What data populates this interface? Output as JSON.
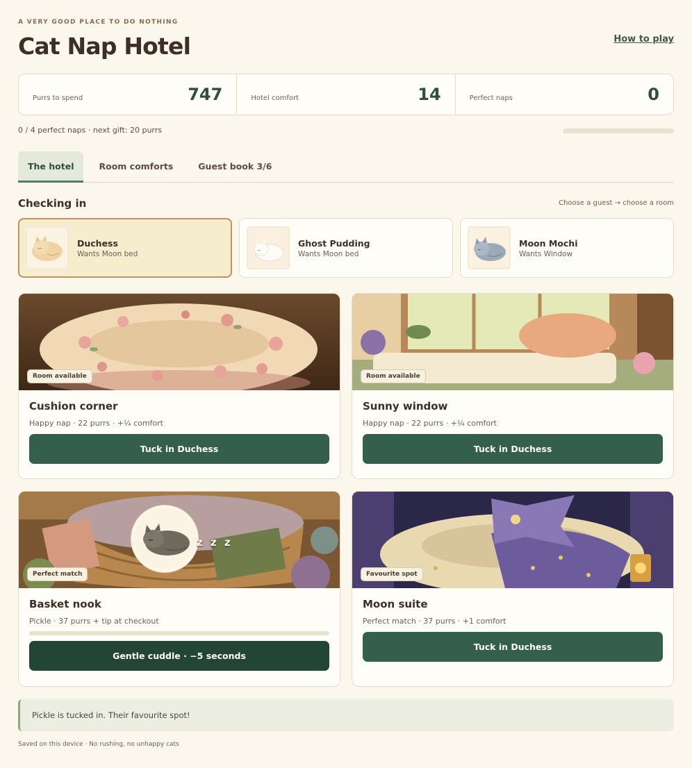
{
  "header": {
    "eyebrow": "A VERY GOOD PLACE TO DO NOTHING",
    "title": "Cat Nap Hotel",
    "how_to_play": "How to play"
  },
  "stats": [
    {
      "label": "Purrs to spend",
      "value": "747"
    },
    {
      "label": "Hotel comfort",
      "value": "14"
    },
    {
      "label": "Perfect naps",
      "value": "0"
    }
  ],
  "progress": {
    "text": "0 / 4 perfect naps · next gift: 20 purrs",
    "fraction": 0
  },
  "tabs": [
    "The hotel",
    "Room comforts",
    "Guest book 3/6"
  ],
  "checkin": {
    "title": "Checking in",
    "hint": "Choose a guest → choose a room"
  },
  "guests": [
    {
      "name": "Duchess",
      "wants": "Wants Moon bed",
      "selected": true
    },
    {
      "name": "Ghost Pudding",
      "wants": "Wants Moon bed",
      "selected": false
    },
    {
      "name": "Moon Mochi",
      "wants": "Wants Window",
      "selected": false
    }
  ],
  "rooms": [
    {
      "badge": "Room available",
      "name": "Cushion corner",
      "desc": "Happy nap · 22 purrs · +¼ comfort",
      "button": "Tuck in Duchess"
    },
    {
      "badge": "Room available",
      "name": "Sunny window",
      "desc": "Happy nap · 22 purrs · +¼ comfort",
      "button": "Tuck in Duchess"
    },
    {
      "badge": "Perfect match",
      "name": "Basket nook",
      "desc": "Pickle · 37 purrs + tip at checkout",
      "button": "Gentle cuddle · −5 seconds",
      "zzz": "z z z",
      "nap_progress": 0
    },
    {
      "badge": "Favourite spot",
      "name": "Moon suite",
      "desc": "Perfect match · 37 purrs · +1 comfort",
      "button": "Tuck in Duchess"
    }
  ],
  "toast": "Pickle is tucked in. Their favourite spot!",
  "footer": "Saved on this device · No rushing, no unhappy cats",
  "colors": {
    "background": "#fbf7ec",
    "accent": "#345f4d",
    "selected_border": "#c2915a"
  }
}
